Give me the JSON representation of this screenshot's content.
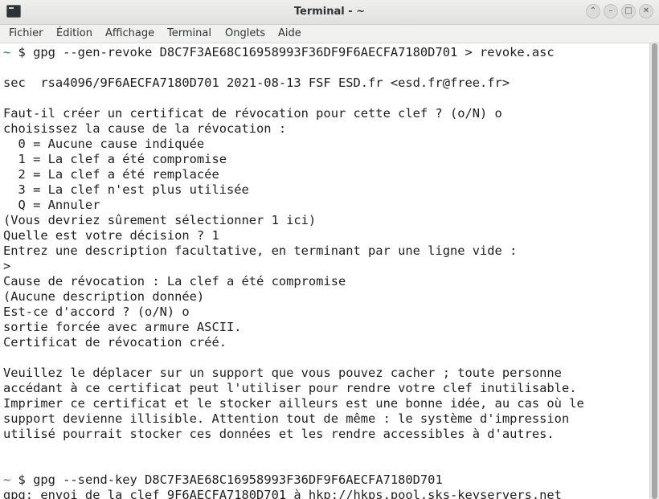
{
  "window": {
    "title": "Terminal - ~",
    "buttons": [
      {
        "name": "window-up-button",
        "icon": "chevron-up-icon",
        "glyph": "⌃"
      },
      {
        "name": "window-minimize-button",
        "icon": "minimize-icon",
        "glyph": "–"
      },
      {
        "name": "window-maximize-button",
        "icon": "maximize-icon",
        "glyph": "□"
      },
      {
        "name": "window-close-button",
        "icon": "close-icon",
        "glyph": "✕"
      }
    ]
  },
  "menubar": {
    "items": [
      "Fichier",
      "Édition",
      "Affichage",
      "Terminal",
      "Onglets",
      "Aide"
    ]
  },
  "terminal": {
    "colors": {
      "foreground": "#1e1e1e",
      "tilde": "#3465a4",
      "background": "#ffffff"
    },
    "lines": [
      {
        "prefix": "~",
        "text": " $ gpg --gen-revoke D8C7F3AE68C16958993F36DF9F6AECFA7180D701 > revoke.asc"
      },
      {
        "prefix": "",
        "text": ""
      },
      {
        "prefix": "",
        "text": "sec  rsa4096/9F6AECFA7180D701 2021-08-13 FSF ESD.fr <esd.fr@free.fr>"
      },
      {
        "prefix": "",
        "text": ""
      },
      {
        "prefix": "",
        "text": "Faut-il créer un certificat de révocation pour cette clef ? (o/N) o"
      },
      {
        "prefix": "",
        "text": "choisissez la cause de la révocation :"
      },
      {
        "prefix": "",
        "text": "  0 = Aucune cause indiquée"
      },
      {
        "prefix": "",
        "text": "  1 = La clef a été compromise"
      },
      {
        "prefix": "",
        "text": "  2 = La clef a été remplacée"
      },
      {
        "prefix": "",
        "text": "  3 = La clef n'est plus utilisée"
      },
      {
        "prefix": "",
        "text": "  Q = Annuler"
      },
      {
        "prefix": "",
        "text": "(Vous devriez sûrement sélectionner 1 ici)"
      },
      {
        "prefix": "",
        "text": "Quelle est votre décision ? 1"
      },
      {
        "prefix": "",
        "text": "Entrez une description facultative, en terminant par une ligne vide :"
      },
      {
        "prefix": "",
        "text": ">"
      },
      {
        "prefix": "",
        "text": "Cause de révocation : La clef a été compromise"
      },
      {
        "prefix": "",
        "text": "(Aucune description donnée)"
      },
      {
        "prefix": "",
        "text": "Est-ce d'accord ? (o/N) o"
      },
      {
        "prefix": "",
        "text": "sortie forcée avec armure ASCII."
      },
      {
        "prefix": "",
        "text": "Certificat de révocation créé."
      },
      {
        "prefix": "",
        "text": ""
      },
      {
        "prefix": "",
        "text": "Veuillez le déplacer sur un support que vous pouvez cacher ; toute personne"
      },
      {
        "prefix": "",
        "text": "accédant à ce certificat peut l'utiliser pour rendre votre clef inutilisable."
      },
      {
        "prefix": "",
        "text": "Imprimer ce certificat et le stocker ailleurs est une bonne idée, au cas où le"
      },
      {
        "prefix": "",
        "text": "support devienne illisible. Attention tout de même : le système d'impression"
      },
      {
        "prefix": "",
        "text": "utilisé pourrait stocker ces données et les rendre accessibles à d'autres."
      },
      {
        "prefix": "",
        "text": ""
      },
      {
        "prefix": "",
        "text": ""
      },
      {
        "prefix": "~",
        "text": " $ gpg --send-key D8C7F3AE68C16958993F36DF9F6AECFA7180D701"
      },
      {
        "prefix": "",
        "text": "gpg: envoi de la clef 9F6AECFA7180D701 à hkp://hkps.pool.sks-keyservers.net"
      }
    ]
  }
}
